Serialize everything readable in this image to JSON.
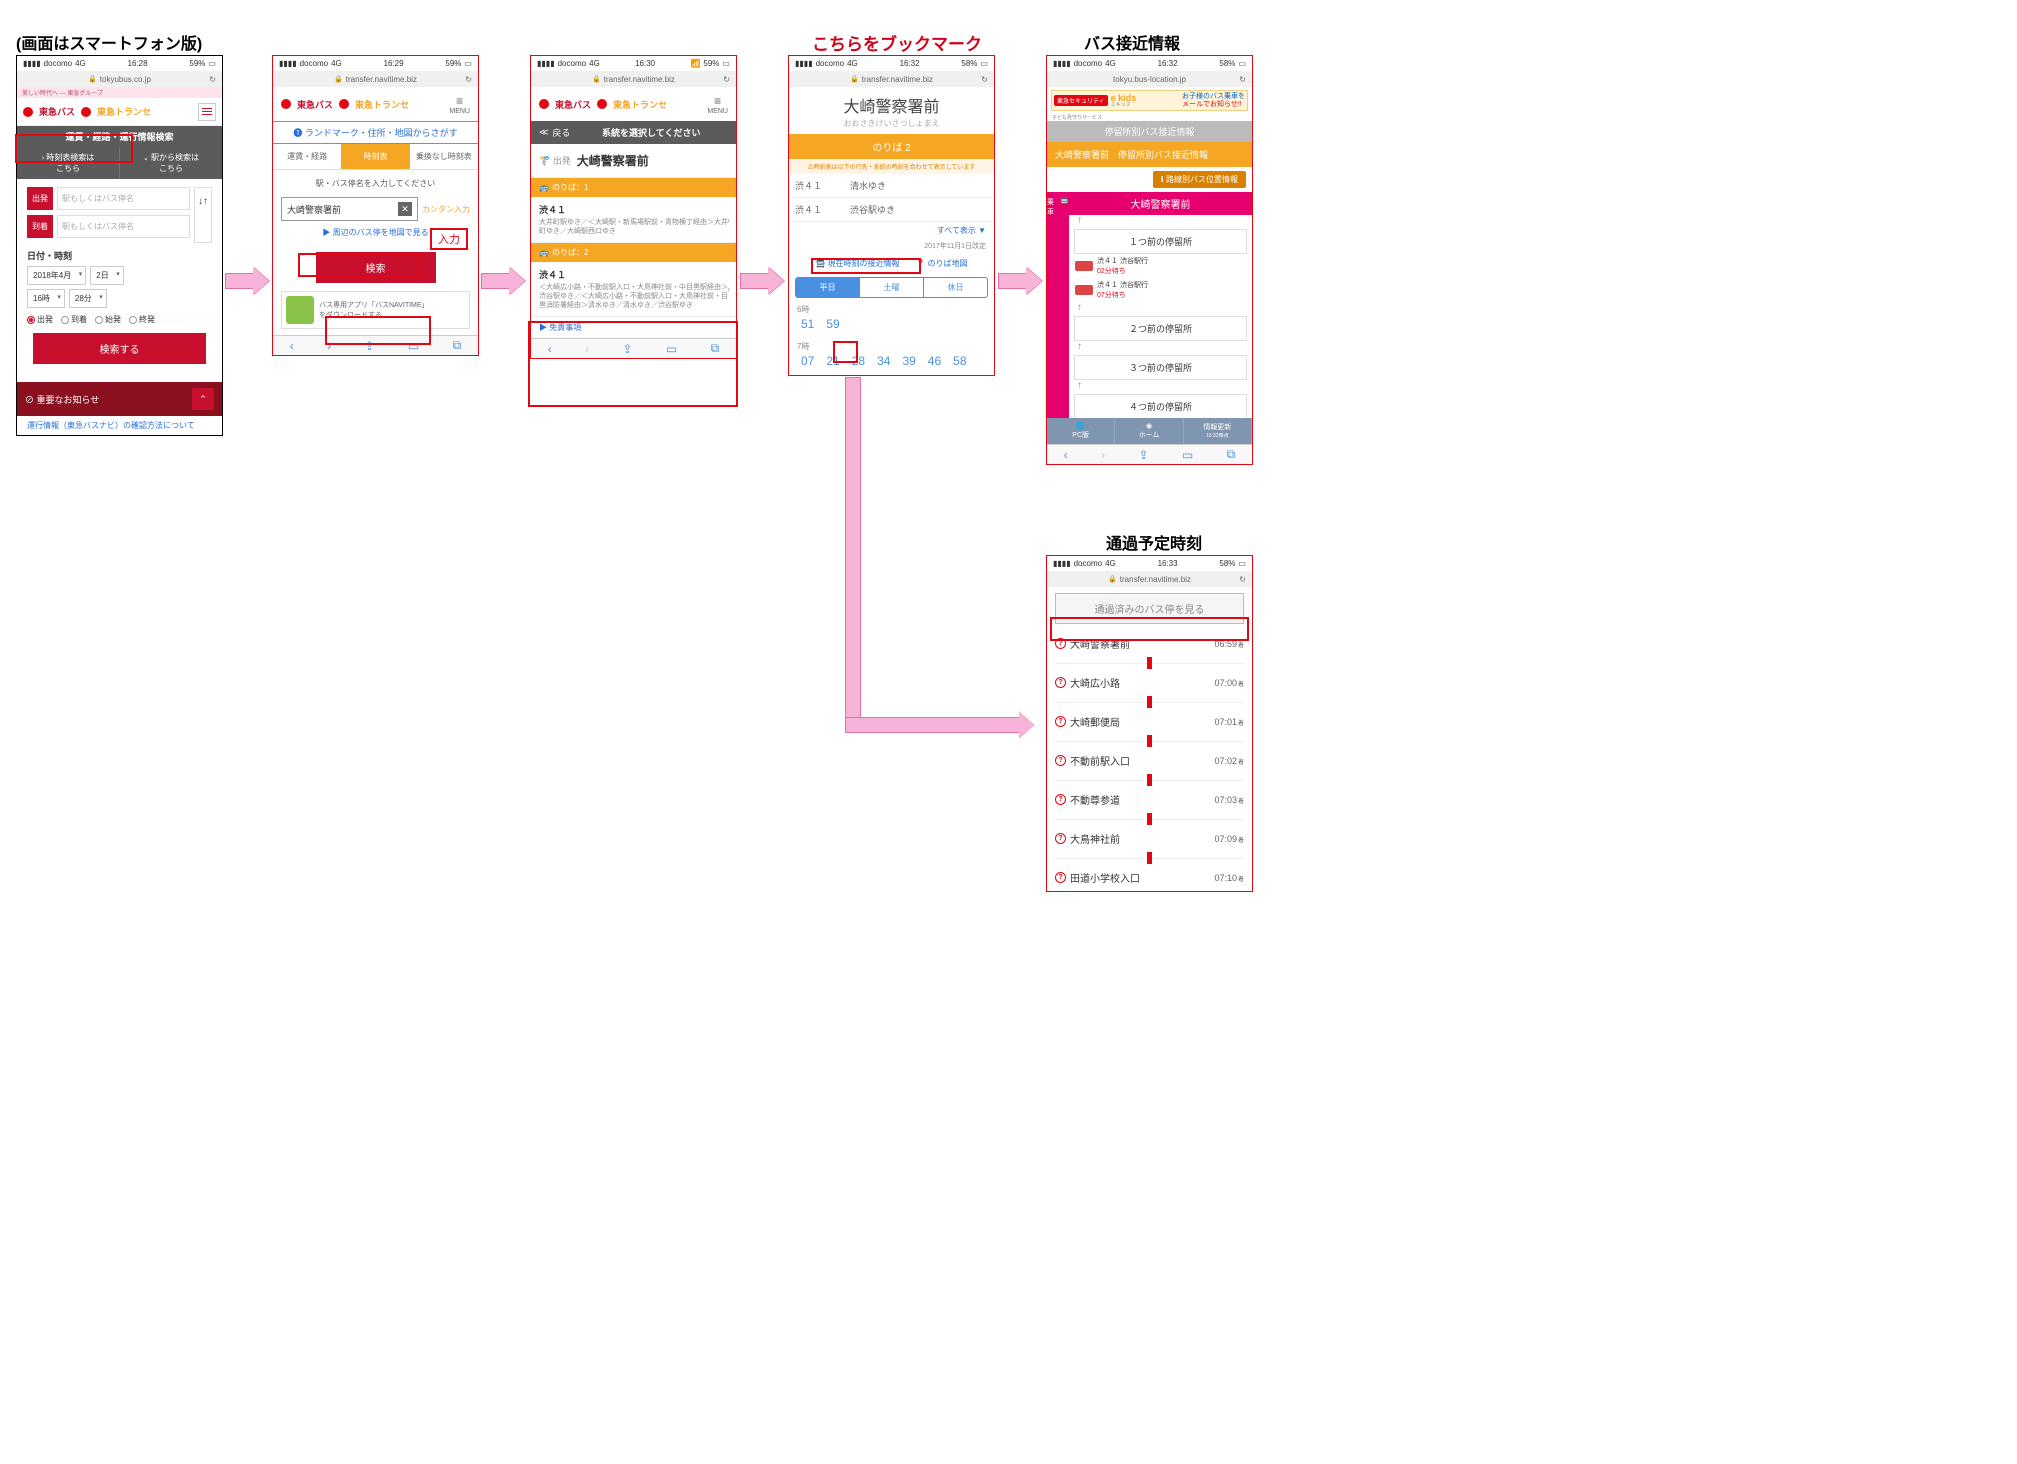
{
  "notes": {
    "smartphone": "(画面はスマートフォン版)",
    "bookmark": "こちらをブックマーク",
    "approach": "バス接近情報",
    "passing": "通過予定時刻",
    "input_annotation": "入力"
  },
  "status": {
    "carrier": "docomo",
    "network": "4G",
    "batt1": "59%",
    "batt4": "58%"
  },
  "times": {
    "t1": "16:28",
    "t2": "16:29",
    "t3": "16:30",
    "t4": "16:32",
    "t5": "16:32",
    "t6": "16:33"
  },
  "urls": {
    "u1": "tokyubus.co.jp",
    "u2": "transfer.navitime.biz",
    "u5": "tokyu.bus-location.jp"
  },
  "brand": {
    "bus": "東急バス",
    "transse": "東急トランセ",
    "menu": "メニュー",
    "topline": "美しい時代へ — 東急グループ"
  },
  "s1": {
    "header": "運賃・経路・運行情報検索",
    "tab1": "時刻表検索は\nこちら",
    "tab2": "駅から検索は\nこちら",
    "dep": "出発",
    "arr": "到着",
    "placeholder": "駅もしくはバス停名",
    "datetime": "日付・時刻",
    "sel_year": "2018年4月",
    "sel_day": "2日",
    "sel_hour": "16時",
    "sel_min": "28分",
    "r_dep": "出発",
    "r_arr": "到着",
    "r_first": "始発",
    "r_last": "終発",
    "search": "検索する",
    "notice": "⊘ 重要なお知らせ",
    "link": "運行情報（東急バスナビ）の確認方法について"
  },
  "s2": {
    "landmark": "❶ ランドマーク・住所・地図からさがす",
    "t1": "運賃・経路",
    "t2": "時刻表",
    "t3": "乗換なし時刻表",
    "instruction": "駅・バス停名を入力してください",
    "input_value": "大崎警察署前",
    "quick": "カンタン入力",
    "maplink": "▶ 周辺のバス停を地図で見る",
    "search": "検索",
    "promo1": "バス専用アプリ「バスNAVITIME」",
    "promo2": "をダウンロードする"
  },
  "s3": {
    "back": "戻る",
    "back_title": "系統を選択してください",
    "dep_label": "🚏 出発",
    "dep_val": "大崎警察署前",
    "plat1": "のりば：1",
    "plat2": "のりば：2",
    "route1": "渋４１",
    "route1sub": "大井町駅ゆき／＜大崎駅・新馬場駅前・青物横丁経由＞大井町ゆき／大崎駅西口ゆき",
    "route2": "渋４１",
    "route2sub": "＜大崎広小路・不動前駅入口・大鳥神社前・中目黒駅経由＞渋谷駅ゆき／＜大崎広小路・不動前駅入口・大鳥神社前・目黒消防署経由＞清水ゆき／清水ゆき／渋谷駅ゆき",
    "disclaimer": "▶ 免責事項"
  },
  "s4": {
    "title": "大崎警察署前",
    "sub": "おおさきけいさつしょまえ",
    "platform": "のりば 2",
    "warn": "⚠時刻表は以下の行先・系統の時刻を合わせて表示しています",
    "r1_rt": "渋４１",
    "r1_dest": "清水ゆき",
    "r2_rt": "渋４１",
    "r2_dest": "渋谷駅ゆき",
    "showall": "すべて表示 ▼",
    "revised": "2017年11月1日改定",
    "link1": "現在時刻の接近情報",
    "link2": "のりば地図",
    "day1": "平日",
    "day2": "土曜",
    "day3": "休日",
    "h6": "6時",
    "m6": [
      "51",
      "59"
    ],
    "h7": "7時",
    "m7": [
      "07",
      "21",
      "28",
      "34",
      "39",
      "46",
      "58"
    ]
  },
  "s5": {
    "banner_brand": "東急セキュリティ",
    "banner_sub": "子ども見守りサービス",
    "banner_ekids": "e kids",
    "banner_ekids_sub": "エキッズ",
    "banner_txt1": "お子様のバス乗車を",
    "banner_txt2": "メールでお知らせ!!",
    "gray": "停留所別バス接近情報",
    "title": "大崎警察署前　停留所別バス接近情報",
    "button": "ℹ 路線別バス位置情報",
    "side": "乗車",
    "stop": "大崎警察署前",
    "prev1": "１つ前の停留所",
    "prev2": "２つ前の停留所",
    "prev3": "３つ前の停留所",
    "prev4": "４つ前の停留所",
    "bus1_rt": "渋４１ 渋谷駅行",
    "bus1_wait": "02分待ち",
    "bus2_rt": "渋４１ 渋谷駅行",
    "bus2_wait": "07分待ち",
    "bot1": "PC版",
    "bot2": "ホーム",
    "bot3": "情報更新",
    "bot3sub": "16:32時点"
  },
  "s6": {
    "btn": "通過済みのバス停を見る",
    "stops": [
      {
        "name": "大崎警察署前",
        "time": "06:59"
      },
      {
        "name": "大崎広小路",
        "time": "07:00"
      },
      {
        "name": "大崎郵便局",
        "time": "07:01"
      },
      {
        "name": "不動前駅入口",
        "time": "07:02"
      },
      {
        "name": "不動尊参道",
        "time": "07:03"
      },
      {
        "name": "大鳥神社前",
        "time": "07:09"
      },
      {
        "name": "田道小学校入口",
        "time": "07:10"
      }
    ],
    "suf": "着"
  }
}
